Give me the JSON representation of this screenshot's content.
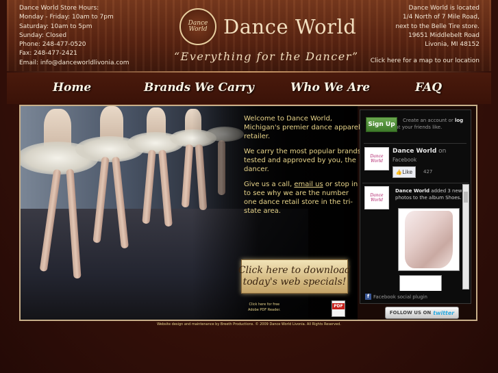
{
  "store_hours": {
    "heading": "Dance World Store Hours:",
    "lines": [
      "Monday - Friday: 10am to 7pm",
      "Saturday: 10am to 5pm",
      "Sunday: Closed",
      "Phone: 248-477-0520",
      "Fax: 248-477-2421",
      "Email: info@danceworldlivonia.com"
    ]
  },
  "logo": {
    "emblem_text_1": "Dance",
    "emblem_text_2": "World",
    "name": "Dance World",
    "tagline": "“Everything for the Dancer”"
  },
  "location": {
    "lines": [
      "Dance World is located",
      "1/4 North of 7 Mile Road,",
      "next to the Belle Tire store.",
      "19651 Middlebelt Road",
      "Livonia, MI 48152"
    ],
    "map_link": "Click here for a map to our location"
  },
  "nav": {
    "home": "Home",
    "brands": "Brands We Carry",
    "who": "Who We Are",
    "faq": "FAQ"
  },
  "welcome": {
    "p1": "Welcome to Dance World, Michigan's premier dance apparel retailer.",
    "p2": "We carry the most popular brands tested and approved by you, the dancer.",
    "p3_before": "Give us a call, ",
    "p3_link": "email us",
    "p3_after": " or stop in to see why we are the number one dance retail store in the tri-state area."
  },
  "specials": {
    "line1": "Click here to download",
    "line2": "today's web specials!"
  },
  "pdf": {
    "line1": "Click here for free",
    "line2": "Adobe PDF Reader.",
    "icon_label": "PDF"
  },
  "facebook": {
    "signup": "Sign Up",
    "create_prefix": "Create an account or ",
    "login": "log in",
    "create_suffix": " to see what your friends like.",
    "page_name": "Dance World",
    "page_suffix": " on",
    "platform": "Facebook",
    "like": "Like",
    "like_count": "427",
    "post_author": "Dance World",
    "post_line1_suffix": " added 3 new",
    "post_line2": "photos to the album Shoes.",
    "thumb_text_1": "Dance",
    "thumb_text_2": "World",
    "plugin_label": "Facebook social plugin",
    "plugin_icon": "f"
  },
  "twitter": {
    "prefix": "FOLLOW US ON",
    "brand": "twitter"
  },
  "footer": "Website design and maintenance by Breeth Productions.     © 2009 Dance World Livonia. All Rights Reserved."
}
